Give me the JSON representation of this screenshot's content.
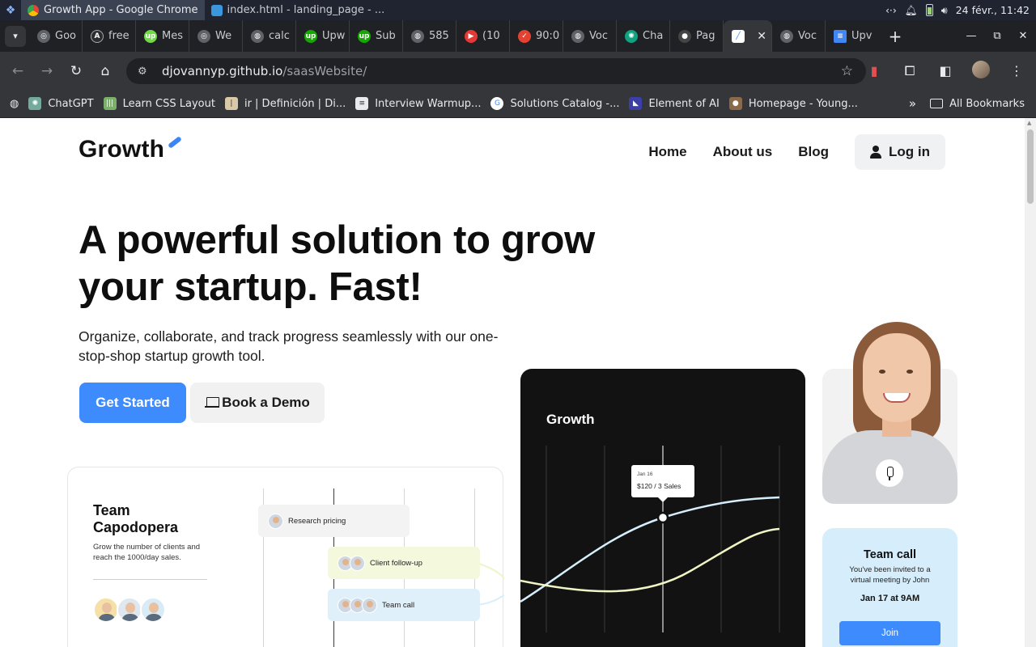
{
  "os": {
    "active_task": "Growth App - Google Chrome",
    "other_task": "index.html - landing_page - ...",
    "datetime": "24 févr., 11:42"
  },
  "browser": {
    "tabs": [
      {
        "label": "Goo",
        "icon": "chrome-icon"
      },
      {
        "label": "free",
        "icon": "openai-icon"
      },
      {
        "label": "Mes",
        "icon": "upwork-icon"
      },
      {
        "label": "We",
        "icon": "chrome-icon"
      },
      {
        "label": "calc",
        "icon": "globe-icon"
      },
      {
        "label": "Upw",
        "icon": "upwork-icon"
      },
      {
        "label": "Sub",
        "icon": "upwork-icon"
      },
      {
        "label": "585",
        "icon": "globe-icon"
      },
      {
        "label": "(10",
        "icon": "youtube-icon"
      },
      {
        "label": "90:0",
        "icon": "todoist-icon"
      },
      {
        "label": "Voc",
        "icon": "globe-icon"
      },
      {
        "label": "Cha",
        "icon": "chatgpt-icon"
      },
      {
        "label": "Pag",
        "icon": "github-icon"
      },
      {
        "label": "",
        "icon": "growth-icon",
        "active": true
      },
      {
        "label": "Voc",
        "icon": "globe-icon"
      },
      {
        "label": "Upv",
        "icon": "docs-icon"
      }
    ],
    "url_domain": "djovannyp.github.io",
    "url_path": "/saasWebsite/",
    "bookmarks": [
      {
        "label": "ChatGPT",
        "icon": "chatgpt-icon"
      },
      {
        "label": "Learn CSS Layout",
        "icon": "css-icon"
      },
      {
        "label": "ir | Definición | Di...",
        "icon": "dictionary-icon"
      },
      {
        "label": "Interview Warmup...",
        "icon": "interview-icon"
      },
      {
        "label": "Solutions Catalog -...",
        "icon": "google-icon"
      },
      {
        "label": "Element of AI",
        "icon": "elements-icon"
      },
      {
        "label": "Homepage - Young...",
        "icon": "person-icon"
      }
    ],
    "all_bookmarks": "All Bookmarks"
  },
  "site": {
    "logo": "Growth",
    "nav": {
      "home": "Home",
      "about": "About us",
      "blog": "Blog",
      "login": "Log in"
    },
    "hero": {
      "title": "A powerful solution to grow your startup. Fast!",
      "subtitle": "Organize, collaborate, and track progress seamlessly with our one-stop-shop startup growth tool.",
      "primary_cta": "Get Started",
      "secondary_cta": "Book a Demo"
    },
    "team_card": {
      "title": "Team Capodopera",
      "description": "Grow the number of clients and reach the 1000/day sales.",
      "tasks": [
        "Research pricing",
        "Client follow-up",
        "Team call"
      ]
    },
    "growth_card": {
      "title": "Growth",
      "tooltip_date": "Jan 16",
      "tooltip_value": "$120 / 3 Sales"
    },
    "call_card": {
      "title": "Team call",
      "description": "You've been invited to a virtual meeting by John",
      "time": "Jan 17 at 9AM",
      "join": "Join"
    }
  }
}
